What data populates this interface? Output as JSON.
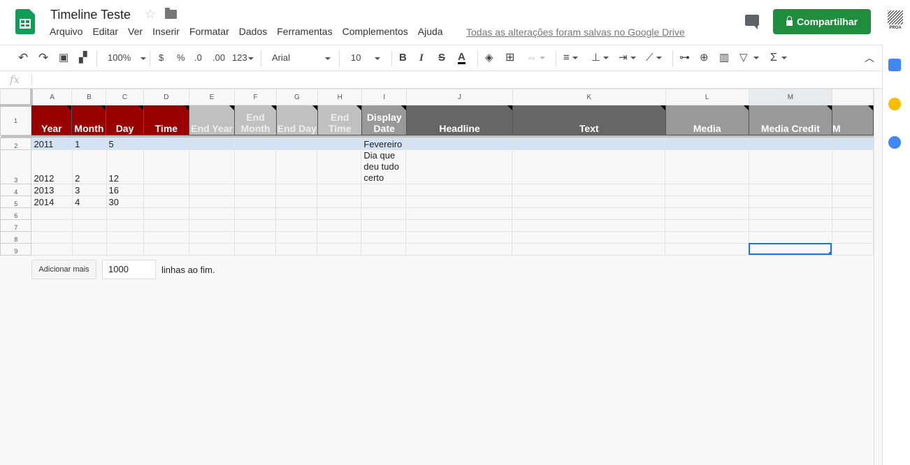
{
  "app": {
    "title": "Timeline Teste",
    "saved_status": "Todas as alterações foram salvas no Google Drive",
    "share_label": "Compartilhar",
    "avatar_text": "PROA"
  },
  "menu": [
    "Arquivo",
    "Editar",
    "Ver",
    "Inserir",
    "Formatar",
    "Dados",
    "Ferramentas",
    "Complementos",
    "Ajuda"
  ],
  "toolbar": {
    "zoom": "100%",
    "currency": "$",
    "percent": "%",
    "dec_less": ".0",
    "dec_more": ".00",
    "format_more": "123",
    "font": "Arial",
    "font_size": "10",
    "bold": "B",
    "italic": "I",
    "strike": "S",
    "text_color": "A",
    "sigma": "Σ"
  },
  "formula_bar": {
    "fx": "fx",
    "value": ""
  },
  "columns": [
    "A",
    "B",
    "C",
    "D",
    "E",
    "F",
    "G",
    "H",
    "I",
    "J",
    "K",
    "L",
    "M",
    ""
  ],
  "header_row": {
    "row_label": "1",
    "cells": [
      "Year",
      "Month",
      "Day",
      "Time",
      "End Year",
      "End Month",
      "End Day",
      "End Time",
      "Display Date",
      "Headline",
      "Text",
      "Media",
      "Media Credit",
      "M"
    ]
  },
  "rows": [
    {
      "label": "2",
      "cells": [
        "2011",
        "1",
        "5",
        "",
        "",
        "",
        "",
        "",
        "Fevereiro",
        "",
        "",
        "",
        "",
        ""
      ]
    },
    {
      "label": "3",
      "cells": [
        "2012",
        "2",
        "12",
        "",
        "",
        "",
        "",
        "",
        "Dia que deu tudo certo",
        "",
        "",
        "",
        "",
        ""
      ]
    },
    {
      "label": "4",
      "cells": [
        "2013",
        "3",
        "16",
        "",
        "",
        "",
        "",
        "",
        "",
        "",
        "",
        "",
        "",
        ""
      ]
    },
    {
      "label": "5",
      "cells": [
        "2014",
        "4",
        "30",
        "",
        "",
        "",
        "",
        "",
        "",
        "",
        "",
        "",
        "",
        ""
      ]
    },
    {
      "label": "6",
      "cells": [
        "",
        "",
        "",
        "",
        "",
        "",
        "",
        "",
        "",
        "",
        "",
        "",
        "",
        ""
      ]
    },
    {
      "label": "7",
      "cells": [
        "",
        "",
        "",
        "",
        "",
        "",
        "",
        "",
        "",
        "",
        "",
        "",
        "",
        ""
      ]
    },
    {
      "label": "8",
      "cells": [
        "",
        "",
        "",
        "",
        "",
        "",
        "",
        "",
        "",
        "",
        "",
        "",
        "",
        ""
      ]
    },
    {
      "label": "9",
      "cells": [
        "",
        "",
        "",
        "",
        "",
        "",
        "",
        "",
        "",
        "",
        "",
        "",
        "",
        ""
      ]
    }
  ],
  "add_rows": {
    "button": "Adicionar mais",
    "count": "1000",
    "suffix": "linhas ao fim."
  },
  "colors": {
    "red_header": "#990000",
    "dark_header": "#666666",
    "share_green": "#1e8e3e",
    "selection": "#1a73e8"
  }
}
